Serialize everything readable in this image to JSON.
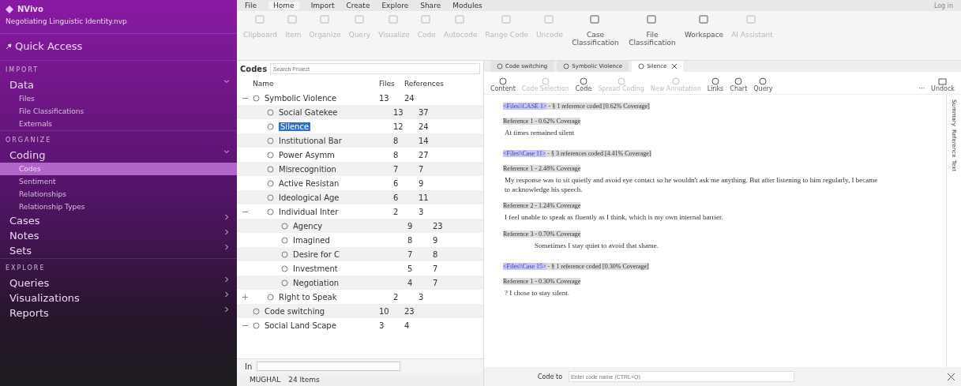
{
  "app": {
    "name": "NVivo",
    "project": "Negotiating Linguistic Identity.nvp"
  },
  "quick_access": "Quick Access",
  "nav": [
    {
      "kind": "header",
      "label": "IMPORT"
    },
    {
      "kind": "group",
      "label": "Data",
      "expanded": true,
      "children": [
        {
          "label": "Files",
          "selected": false
        },
        {
          "label": "File Classifications",
          "selected": false
        },
        {
          "label": "Externals",
          "selected": false
        }
      ]
    },
    {
      "kind": "header",
      "label": "ORGANIZE"
    },
    {
      "kind": "group",
      "label": "Coding",
      "expanded": true,
      "children": [
        {
          "label": "Codes",
          "selected": true
        },
        {
          "label": "Sentiment",
          "selected": false
        },
        {
          "label": "Relationships",
          "selected": false
        },
        {
          "label": "Relationship Types",
          "selected": false
        }
      ]
    },
    {
      "kind": "group",
      "label": "Cases",
      "expanded": false
    },
    {
      "kind": "group",
      "label": "Notes",
      "expanded": false
    },
    {
      "kind": "group",
      "label": "Sets",
      "expanded": false
    },
    {
      "kind": "header",
      "label": "EXPLORE"
    },
    {
      "kind": "group",
      "label": "Queries",
      "expanded": false
    },
    {
      "kind": "group",
      "label": "Visualizations",
      "expanded": false
    },
    {
      "kind": "group",
      "label": "Reports",
      "expanded": false
    }
  ],
  "ribbon_tabs": [
    {
      "label": "File",
      "selected": false
    },
    {
      "label": "Home",
      "selected": true
    },
    {
      "label": "Import",
      "selected": false
    },
    {
      "label": "Create",
      "selected": false
    },
    {
      "label": "Explore",
      "selected": false
    },
    {
      "label": "Share",
      "selected": false
    },
    {
      "label": "Modules",
      "selected": false
    }
  ],
  "login": "Log in",
  "ribbon_buttons": [
    {
      "label": "Clipboard",
      "disabled": true
    },
    {
      "label": "Item",
      "disabled": true
    },
    {
      "label": "Organize",
      "disabled": true
    },
    {
      "label": "Query",
      "disabled": true
    },
    {
      "label": "Visualize",
      "disabled": true
    },
    {
      "label": "Code",
      "disabled": true
    },
    {
      "label": "Autocode",
      "disabled": true
    },
    {
      "label": "Range Code",
      "disabled": true
    },
    {
      "label": "Uncode",
      "disabled": true
    },
    {
      "label": "Case Classification",
      "disabled": false
    },
    {
      "label": "File Classification",
      "disabled": false
    },
    {
      "label": "Workspace",
      "disabled": false
    },
    {
      "label": "AI Assistant",
      "disabled": true
    }
  ],
  "codes": {
    "title": "Codes",
    "search": {
      "placeholder": "Search Project"
    },
    "columns": [
      "Name",
      "Files",
      "References"
    ],
    "rows": [
      {
        "name": "Symbolic Violence",
        "files": "13",
        "references": "24",
        "selected": false,
        "expanded": true,
        "children": [
          {
            "name": "Social Gatekee",
            "files": "13",
            "references": "37",
            "selected": false
          },
          {
            "name": "Silence",
            "files": "12",
            "references": "24",
            "selected": true
          },
          {
            "name": "Institutional Bar",
            "files": "8",
            "references": "14",
            "selected": false
          },
          {
            "name": "Power Asymm",
            "files": "8",
            "references": "27",
            "selected": false
          },
          {
            "name": "Misrecognition",
            "files": "7",
            "references": "7",
            "selected": false
          },
          {
            "name": "Active Resistan",
            "files": "6",
            "references": "9",
            "selected": false
          },
          {
            "name": "Ideological Age",
            "files": "6",
            "references": "11",
            "selected": false
          },
          {
            "name": "Individual Inter",
            "files": "2",
            "references": "3",
            "selected": false,
            "expanded": true,
            "children": [
              {
                "name": "Agency",
                "files": "9",
                "references": "23",
                "selected": false
              },
              {
                "name": "Imagined",
                "files": "8",
                "references": "9",
                "selected": false
              },
              {
                "name": "Desire for C",
                "files": "7",
                "references": "8",
                "selected": false
              },
              {
                "name": "Investment",
                "files": "5",
                "references": "7",
                "selected": false
              },
              {
                "name": "Negotiation",
                "files": "4",
                "references": "7",
                "selected": false
              }
            ]
          },
          {
            "name": "Right to Speak",
            "files": "2",
            "references": "3",
            "selected": false,
            "expanded": false
          }
        ]
      },
      {
        "name": "Code switching",
        "files": "10",
        "references": "23",
        "selected": false
      },
      {
        "name": "Social Land Scape",
        "files": "3",
        "references": "4",
        "selected": false,
        "expanded": true
      }
    ],
    "in_label": "In"
  },
  "status": {
    "user": "MUGHAL",
    "count": "24 Items"
  },
  "doc_tabs": [
    {
      "label": "Code switching",
      "selected": false
    },
    {
      "label": "Symbolic Violence",
      "selected": false
    },
    {
      "label": "Silence",
      "selected": true
    }
  ],
  "doc_tools": [
    {
      "label": "Content",
      "disabled": false
    },
    {
      "label": "Code Selection",
      "disabled": true
    },
    {
      "label": "Code",
      "disabled": false
    },
    {
      "label": "Spread Coding",
      "disabled": true
    },
    {
      "label": "New Annotation",
      "disabled": true
    },
    {
      "label": "Links",
      "disabled": false
    },
    {
      "label": "Chart",
      "disabled": false
    },
    {
      "label": "Query",
      "disabled": false
    }
  ],
  "more": "···",
  "undock": "Undock",
  "side_tabs": [
    "Summary",
    "Reference",
    "Text"
  ],
  "content": [
    {
      "kind": "source",
      "link": "<Files\\\\CASE 1>",
      "detail": " - § 1 reference coded  [0.62% Coverage]"
    },
    {
      "kind": "reference",
      "text": "Reference 1 - 0.62% Coverage"
    },
    {
      "kind": "text",
      "text": "At times remained silent",
      "indented": false
    },
    {
      "kind": "source",
      "link": "<Files\\\\Case 11>",
      "detail": " - § 3 references coded  [4.41% Coverage]"
    },
    {
      "kind": "reference",
      "text": "Reference 1 - 2.48% Coverage"
    },
    {
      "kind": "text",
      "text": "My response was to sit quietly and avoid eye contact so he wouldn't ask me anything. But after listening to him regularly, I became to acknowledge his speech.",
      "indented": false
    },
    {
      "kind": "reference",
      "text": "Reference 2 - 1.24% Coverage"
    },
    {
      "kind": "text",
      "text": "I feel unable to speak as fluently as I think, which is my own internal barrier.",
      "indented": false
    },
    {
      "kind": "reference",
      "text": "Reference 3 - 0.70% Coverage"
    },
    {
      "kind": "text",
      "text": "Sometimes I stay quiet to avoid that shame.",
      "indented": true
    },
    {
      "kind": "source",
      "link": "<Files\\\\Case 15>",
      "detail": " - § 1 reference coded  [0.30% Coverage]"
    },
    {
      "kind": "reference",
      "text": "Reference 1 - 0.30% Coverage"
    },
    {
      "kind": "text",
      "text": "? I chose to stay silent.",
      "indented": false
    }
  ],
  "code_to": {
    "label": "Code to",
    "placeholder": "Enter code name (CTRL+Q)"
  }
}
